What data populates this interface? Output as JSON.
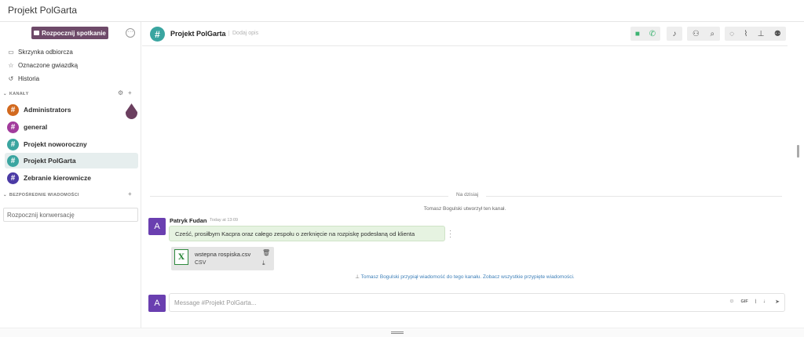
{
  "app": {
    "title": "Projekt PolGarta"
  },
  "sidebar": {
    "start_meeting_label": "Rozpocznij spotkanie",
    "more_label": "···",
    "nav": [
      {
        "label": "Skrzynka odbiorcza",
        "icon": "inbox-icon"
      },
      {
        "label": "Oznaczone gwiazdką",
        "icon": "star-icon"
      },
      {
        "label": "Historia",
        "icon": "history-icon"
      }
    ],
    "channels_section": "KANAŁY",
    "channels": [
      {
        "name": "Administrators",
        "color": "#d2691e"
      },
      {
        "name": "general",
        "color": "#a23b9c"
      },
      {
        "name": "Projekt noworoczny",
        "color": "#3aa5a0"
      },
      {
        "name": "Projekt PolGarta",
        "color": "#3aa5a0",
        "active": true
      },
      {
        "name": "Zebranie kierownicze",
        "color": "#4b3aa5"
      }
    ],
    "dm_section": "BEZPOŚREDNIE WIADOMOŚCI",
    "dm_placeholder": "Rozpocznij konwersację"
  },
  "header": {
    "channel_name": "Projekt PolGarta",
    "add_description": "Dodaj opis"
  },
  "messages": {
    "day_label": "Na dzisiaj",
    "created_notice": "Tomasz Bogulski utworzył ten kanał.",
    "author": "Patryk Fudan",
    "time": "Today at 13:09",
    "avatar_letter": "A",
    "text": "Cześć, prosiłbym Kacpra oraz całego zespołu o zerknięcie na rozpiskę podesłaną od klienta",
    "attachment": {
      "name": "wstepna rospiska.csv",
      "type": "CSV"
    },
    "pinned_notice": "Tomasz Bogulski przypiął wiadomość do tego kanału. Zobacz wszystkie przypięte wiadomości."
  },
  "composer": {
    "avatar_letter": "A",
    "placeholder": "Message #Projekt PolGarta...",
    "gif_label": "GIF"
  },
  "colors": {
    "accent": "#6e4a69",
    "video_green": "#3cb371",
    "bubble": "#e6f3e1",
    "avatar": "#6a3fb0"
  }
}
